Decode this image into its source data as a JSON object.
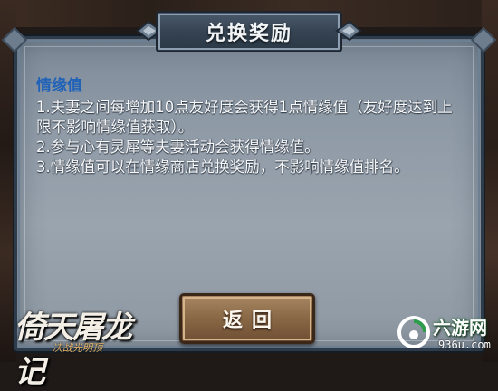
{
  "dialog": {
    "title": "兑换奖励",
    "section_title": "情缘值",
    "paragraphs": [
      "1.夫妻之间每增加10点友好度会获得1点情缘值（友好度达到上限不影响情缘值获取）。",
      "2.参与心有灵犀等夫妻活动会获得情缘值。",
      "3.情缘值可以在情缘商店兑换奖励，不影响情缘值排名。"
    ],
    "return_button": "返回"
  },
  "game_logo": {
    "title": "倚天屠龙记",
    "subtitle": "决战光明顶"
  },
  "watermark": {
    "site_name": "六游网",
    "site_url": "936u.com"
  },
  "colors": {
    "section_title": "#1f62b8",
    "panel": "#8e99a6",
    "button": "#8b6a48"
  }
}
